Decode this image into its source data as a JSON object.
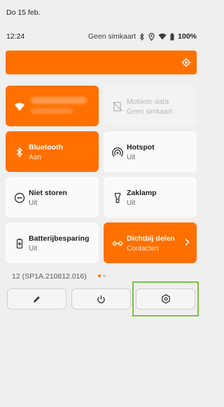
{
  "status": {
    "date": "Do 15 feb.",
    "time": "12:24",
    "sim": "Geen simkaart",
    "battery": "100%"
  },
  "tiles": [
    {
      "title": "",
      "subtitle": "",
      "state": "on",
      "icon": "wifi-icon"
    },
    {
      "title": "Mobiele data",
      "subtitle": "Geen simkaart",
      "state": "disabled",
      "icon": "mobile-data-off-icon"
    },
    {
      "title": "Bluetooth",
      "subtitle": "Aan",
      "state": "on",
      "icon": "bluetooth-icon"
    },
    {
      "title": "Hotspot",
      "subtitle": "Uit",
      "state": "off",
      "icon": "hotspot-icon"
    },
    {
      "title": "Niet storen",
      "subtitle": "Uit",
      "state": "off",
      "icon": "do-not-disturb-icon"
    },
    {
      "title": "Zaklamp",
      "subtitle": "Uit",
      "state": "off",
      "icon": "flashlight-icon"
    },
    {
      "title": "Batterijbesparing",
      "subtitle": "Uit",
      "state": "off",
      "icon": "battery-saver-icon"
    },
    {
      "title": "Dichtbij delen",
      "subtitle": "Contacten",
      "state": "on",
      "icon": "nearby-share-icon"
    }
  ],
  "footer": {
    "build": "12 (SP1A.210812.016)",
    "page_dots": 2,
    "active_page": 1
  },
  "colors": {
    "accent": "#ff7000",
    "tile_off": "#fafafa",
    "background": "#efefef",
    "highlight": "#7bc143"
  },
  "icons": {
    "brightness": "brightness-icon",
    "edit": "pencil-icon",
    "power": "power-icon",
    "settings": "settings-icon"
  }
}
